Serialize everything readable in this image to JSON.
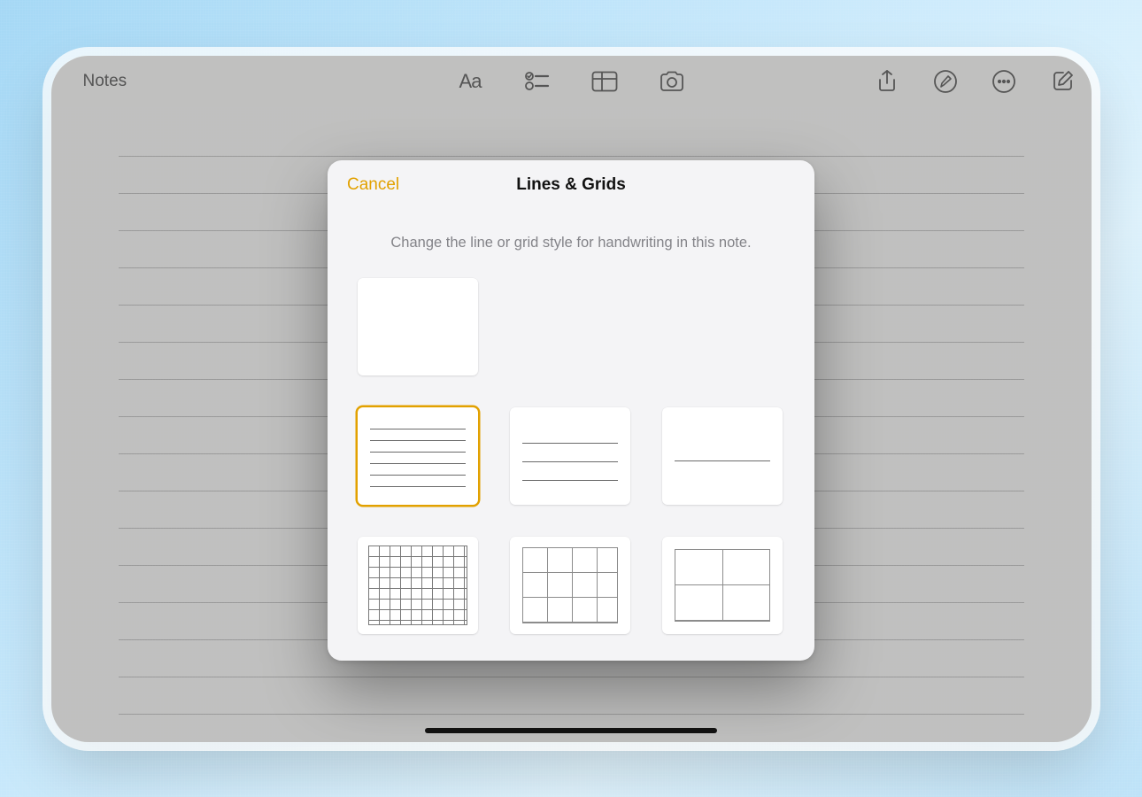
{
  "colors": {
    "accent": "#e2a100",
    "toolbar_icon": "#6d6d6d",
    "page_line": "#c6c6c6",
    "modal_bg": "#f4f4f6"
  },
  "toolbar": {
    "back_label": "Notes"
  },
  "modal": {
    "cancel_label": "Cancel",
    "title": "Lines & Grids",
    "subtitle": "Change the line or grid style for handwriting in this note.",
    "options": [
      {
        "id": "blank",
        "kind": "blank",
        "selected": false
      },
      {
        "id": "lines-dense",
        "kind": "lines-dense",
        "selected": true
      },
      {
        "id": "lines-mid",
        "kind": "lines-mid",
        "selected": false
      },
      {
        "id": "lines-wide",
        "kind": "lines-wide",
        "selected": false
      },
      {
        "id": "grid-dense",
        "kind": "grid-dense",
        "selected": false
      },
      {
        "id": "grid-mid",
        "kind": "grid-mid",
        "selected": false
      },
      {
        "id": "grid-large",
        "kind": "grid-large",
        "selected": false
      }
    ]
  }
}
